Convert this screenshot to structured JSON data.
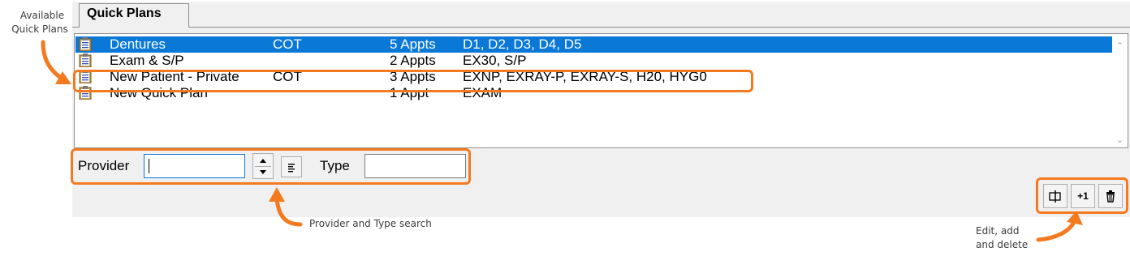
{
  "annotations": {
    "quick_plans_line1": "Available",
    "quick_plans_line2": "Quick Plans",
    "search": "Provider and Type search",
    "actions_line1": "Edit, add",
    "actions_line2": "and delete"
  },
  "tab": {
    "label": "Quick Plans"
  },
  "plans": [
    {
      "name": "Dentures",
      "provider": "COT",
      "appts": "5 Appts",
      "codes": "D1, D2, D3, D4, D5",
      "selected": true
    },
    {
      "name": "Exam & S/P",
      "provider": "",
      "appts": "2 Appts",
      "codes": "EX30, S/P",
      "selected": false
    },
    {
      "name": "New Patient - Private",
      "provider": "COT",
      "appts": "3 Appts",
      "codes": "EXNP, EXRAY-P, EXRAY-S, H20, HYG0",
      "selected": false
    },
    {
      "name": "New Quick Plan",
      "provider": "",
      "appts": "1 Appt",
      "codes": "EXAM",
      "selected": false
    }
  ],
  "search": {
    "provider_label": "Provider",
    "provider_value": "",
    "type_label": "Type",
    "type_value": ""
  },
  "actions": {
    "add_label": "+1"
  },
  "colors": {
    "selection": "#0a78d7",
    "highlight": "#f47a20"
  }
}
